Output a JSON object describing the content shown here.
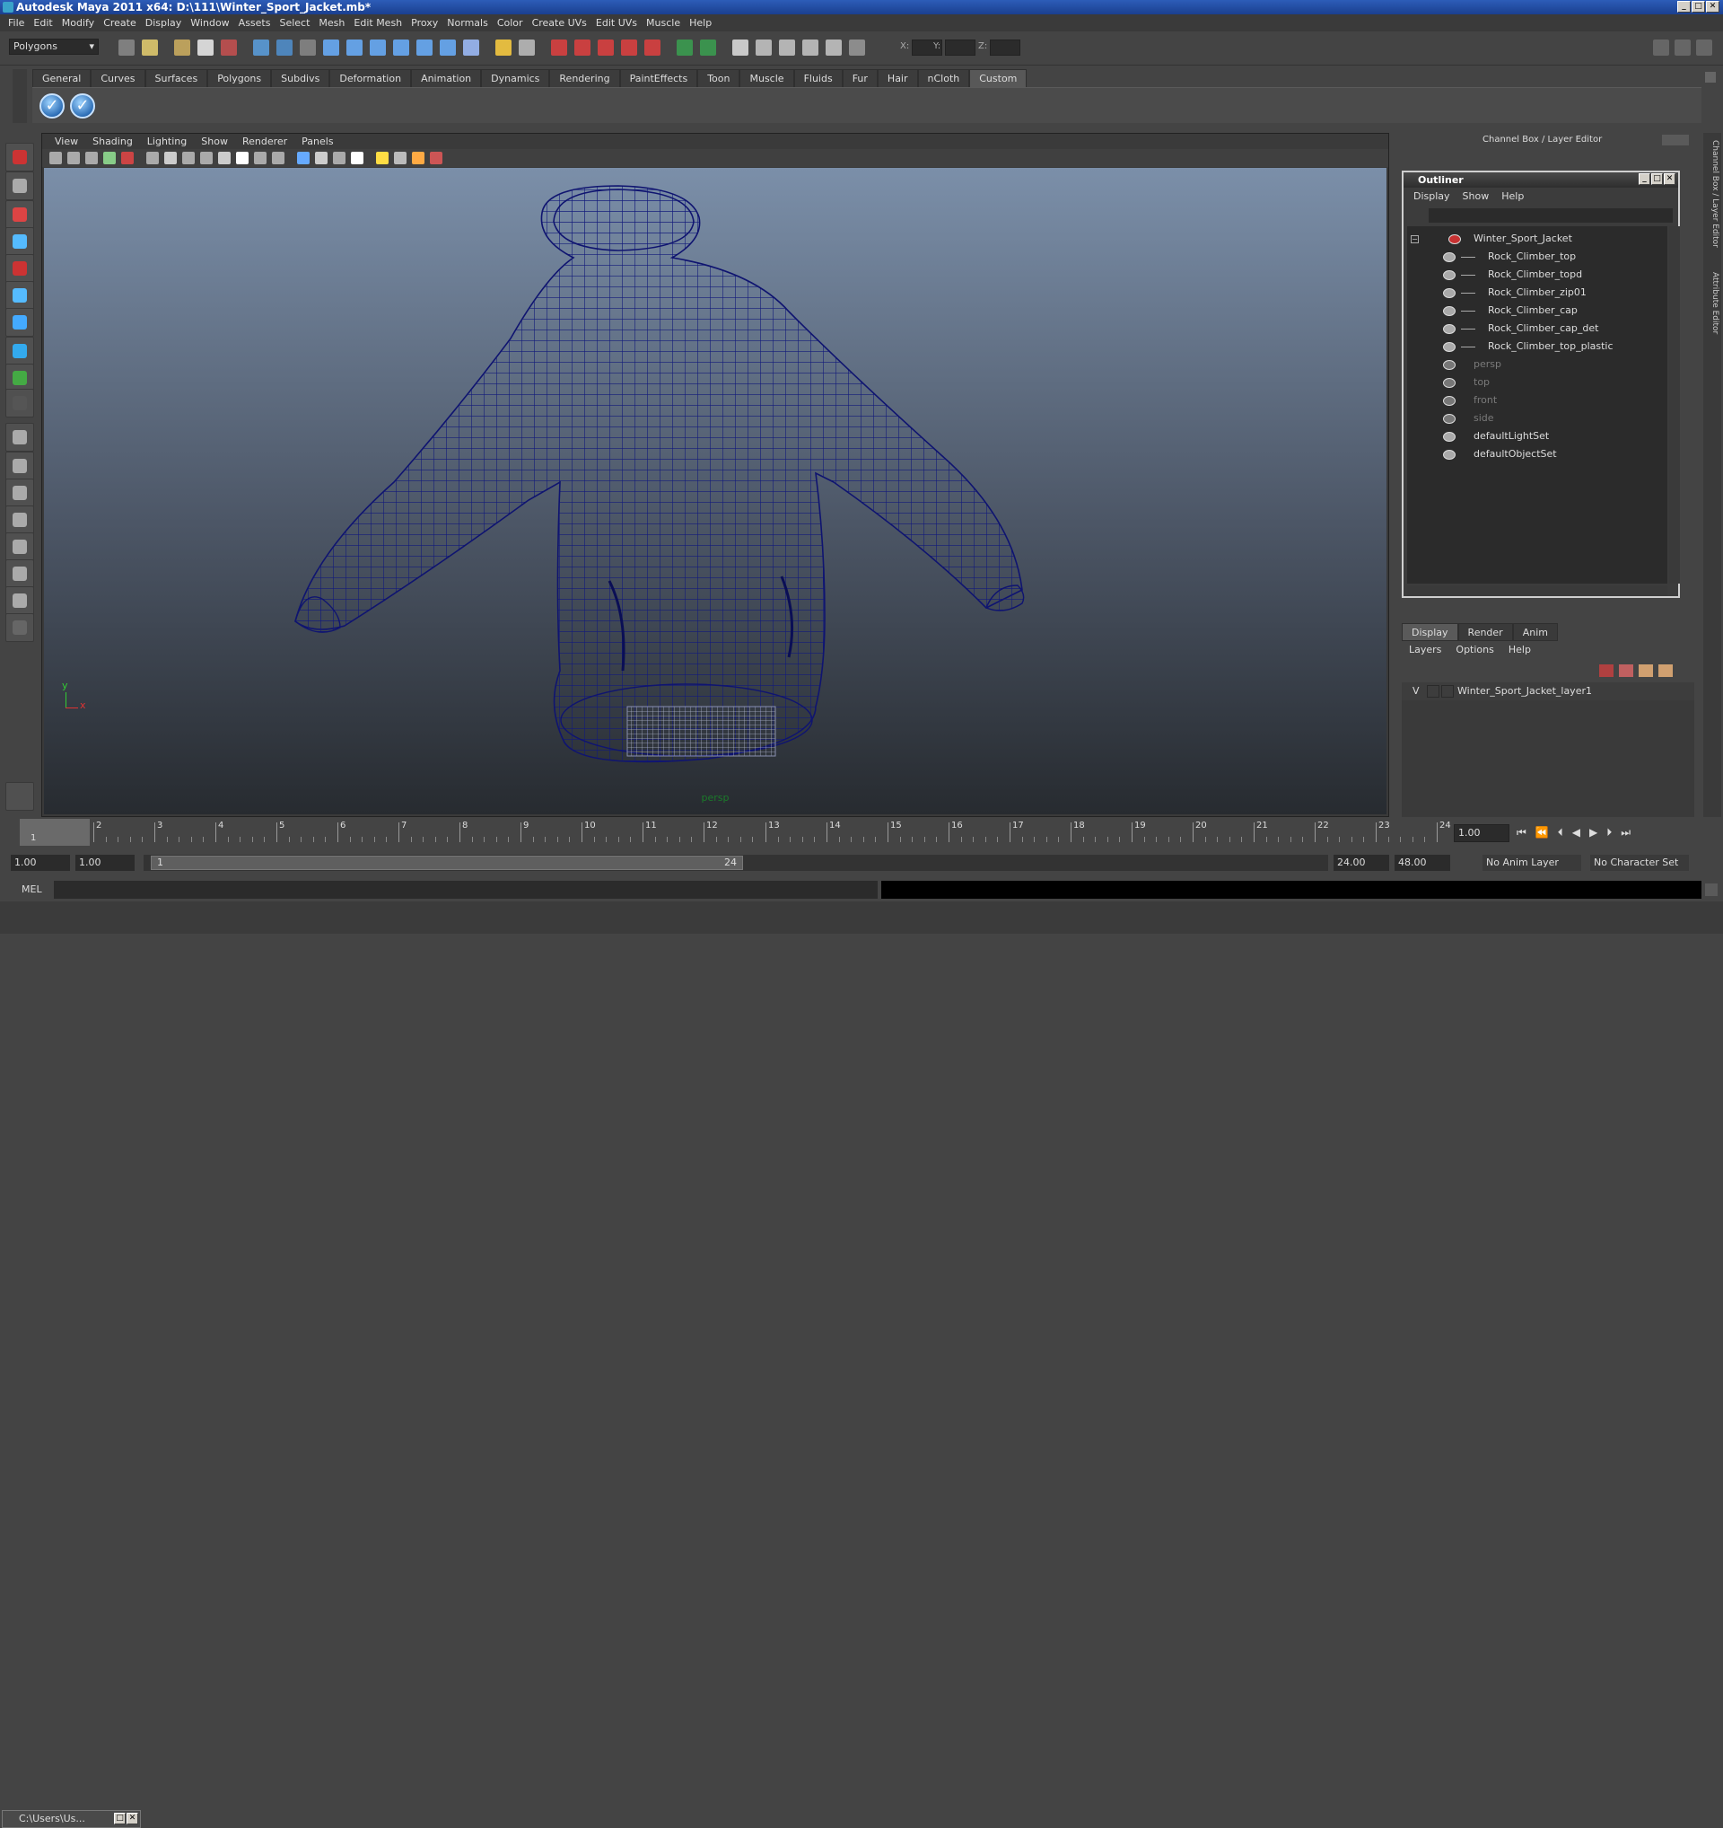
{
  "window": {
    "title": "Autodesk Maya 2011 x64: D:\\111\\Winter_Sport_Jacket.mb*"
  },
  "menubar": [
    "File",
    "Edit",
    "Modify",
    "Create",
    "Display",
    "Window",
    "Assets",
    "Select",
    "Mesh",
    "Edit Mesh",
    "Proxy",
    "Normals",
    "Color",
    "Create UVs",
    "Edit UVs",
    "Muscle",
    "Help"
  ],
  "status": {
    "mode": "Polygons",
    "x_label": "X:",
    "y_label": "Y:",
    "z_label": "Z:"
  },
  "shelf": {
    "tabs": [
      "General",
      "Curves",
      "Surfaces",
      "Polygons",
      "Subdivs",
      "Deformation",
      "Animation",
      "Dynamics",
      "Rendering",
      "PaintEffects",
      "Toon",
      "Muscle",
      "Fluids",
      "Fur",
      "Hair",
      "nCloth",
      "Custom"
    ],
    "active_tab": "Custom"
  },
  "viewport": {
    "menu": [
      "View",
      "Shading",
      "Lighting",
      "Show",
      "Renderer",
      "Panels"
    ],
    "camera": "persp",
    "axis_y": "y",
    "axis_x": "x"
  },
  "channelbox": {
    "label": "Channel Box / Layer Editor",
    "side_tab_1": "Channel Box / Layer Editor",
    "side_tab_2": "Attribute Editor"
  },
  "outliner": {
    "title": "Outliner",
    "menu": [
      "Display",
      "Show",
      "Help"
    ],
    "items": [
      {
        "label": "Winter_Sport_Jacket",
        "indent": 0,
        "dim": false
      },
      {
        "label": "Rock_Climber_top",
        "indent": 1,
        "dim": false
      },
      {
        "label": "Rock_Climber_topd",
        "indent": 1,
        "dim": false
      },
      {
        "label": "Rock_Climber_zip01",
        "indent": 1,
        "dim": false
      },
      {
        "label": "Rock_Climber_cap",
        "indent": 1,
        "dim": false
      },
      {
        "label": "Rock_Climber_cap_det",
        "indent": 1,
        "dim": false
      },
      {
        "label": "Rock_Climber_top_plastic",
        "indent": 1,
        "dim": false
      },
      {
        "label": "persp",
        "indent": 0,
        "dim": true
      },
      {
        "label": "top",
        "indent": 0,
        "dim": true
      },
      {
        "label": "front",
        "indent": 0,
        "dim": true
      },
      {
        "label": "side",
        "indent": 0,
        "dim": true
      },
      {
        "label": "defaultLightSet",
        "indent": 0,
        "dim": false
      },
      {
        "label": "defaultObjectSet",
        "indent": 0,
        "dim": false
      }
    ]
  },
  "layers": {
    "tabs": [
      "Display",
      "Render",
      "Anim"
    ],
    "active_tab": "Display",
    "menu": [
      "Layers",
      "Options",
      "Help"
    ],
    "visible_flag": "V",
    "layer_name": "Winter_Sport_Jacket_layer1"
  },
  "timeline": {
    "ticks": [
      "1",
      "2",
      "3",
      "4",
      "5",
      "6",
      "7",
      "8",
      "9",
      "10",
      "11",
      "12",
      "13",
      "14",
      "15",
      "16",
      "17",
      "18",
      "19",
      "20",
      "21",
      "22",
      "23",
      "24"
    ],
    "current_frame": "1.00",
    "playhead_label": "1"
  },
  "range": {
    "start": "1.00",
    "playback_start": "1.00",
    "slider_start": "1",
    "slider_end": "24",
    "playback_end": "24.00",
    "end": "48.00",
    "anim_layer": "No Anim Layer",
    "char_set": "No Character Set"
  },
  "cmdline": {
    "label": "MEL"
  },
  "taskbar": {
    "label": "C:\\Users\\Us..."
  }
}
